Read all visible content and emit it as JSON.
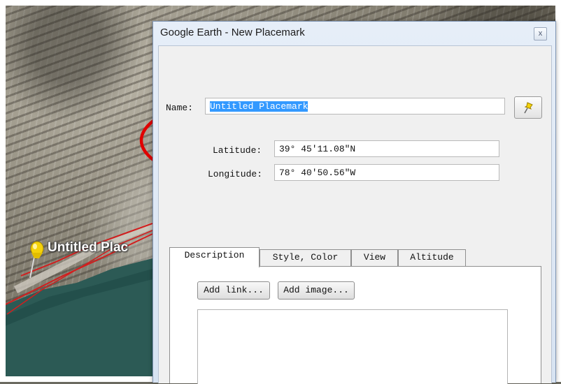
{
  "map": {
    "placemark_label": "Untitled Plac"
  },
  "dialog": {
    "title": "Google Earth - New Placemark",
    "close_label": "x",
    "name_label": "Name:",
    "name_value": "Untitled Placemark",
    "latitude_label": "Latitude:",
    "latitude_value": "39° 45′11.08″N",
    "longitude_label": "Longitude:",
    "longitude_value": "78° 40′50.56″W",
    "tabs": [
      {
        "label": "Description",
        "active": true
      },
      {
        "label": "Style, Color",
        "active": false
      },
      {
        "label": "View",
        "active": false
      },
      {
        "label": "Altitude",
        "active": false
      }
    ],
    "add_link_label": "Add link...",
    "add_image_label": "Add image..."
  },
  "colors": {
    "annotation": "#e00000",
    "selection": "#3399ff",
    "pin": "#f5d20a"
  }
}
